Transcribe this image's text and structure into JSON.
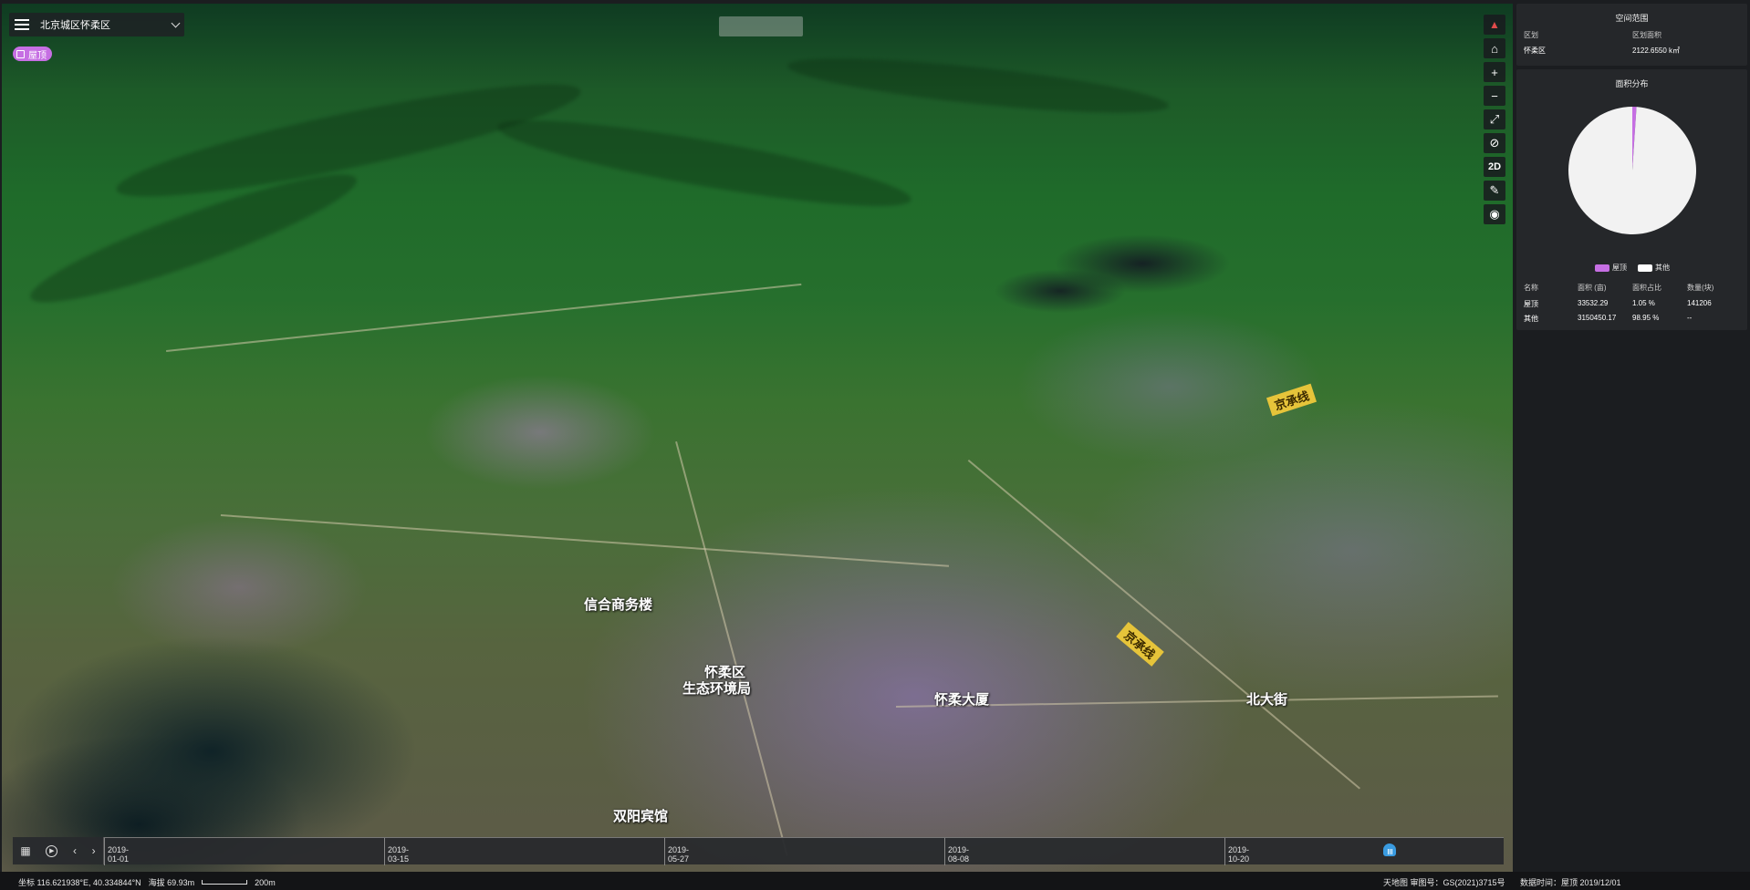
{
  "header": {
    "district": "北京城区怀柔区",
    "layer_chip": "屋顶"
  },
  "map": {
    "labels": [
      {
        "text": "京承线"
      },
      {
        "text": "京承线"
      }
    ],
    "places": [
      {
        "text": "信合商务楼"
      },
      {
        "text": "怀柔区"
      },
      {
        "text": "生态环境局"
      },
      {
        "text": "怀柔大厦"
      },
      {
        "text": "北大街"
      },
      {
        "text": "双阳宾馆"
      }
    ]
  },
  "toolbar": {
    "compass": "compass-icon",
    "home": "home-icon",
    "zoom_in": "+",
    "zoom_out": "−",
    "fullscreen": "fullscreen-icon",
    "visibility": "eye-off-icon",
    "mode": "2D",
    "measure": "ruler-icon",
    "locate": "locate-icon"
  },
  "timeline": {
    "ticks": [
      "2019-01-01",
      "2019-03-15",
      "2019-05-27",
      "2019-08-08",
      "2019-10-20"
    ]
  },
  "status": {
    "coords": "坐标 116.621938°E, 40.334844°N",
    "elevation": "海拔 69.93m",
    "scale": "200m",
    "source": "天地图 审图号：GS(2021)3715号",
    "data_time": "数据时间：屋顶 2019/12/01"
  },
  "spatial_panel": {
    "title": "空间范围",
    "head_district": "区划",
    "head_area": "区划面积",
    "district": "怀柔区",
    "area": "2122.6550 k㎡"
  },
  "area_panel": {
    "title": "面积分布",
    "legend": [
      {
        "name": "屋顶",
        "color": "#c66fe3"
      },
      {
        "name": "其他",
        "color": "#ffffff"
      }
    ],
    "columns": [
      "名称",
      "面积 (亩)",
      "面积占比",
      "数量(块)"
    ],
    "rows": [
      [
        "屋顶",
        "33532.29",
        "1.05 %",
        "141206"
      ],
      [
        "其他",
        "3150450.17",
        "98.95 %",
        "--"
      ]
    ]
  },
  "chart_data": {
    "type": "pie",
    "title": "面积分布",
    "categories": [
      "屋顶",
      "其他"
    ],
    "values": [
      1.05,
      98.95
    ],
    "colors": [
      "#c66fe3",
      "#f2f2f2"
    ]
  }
}
